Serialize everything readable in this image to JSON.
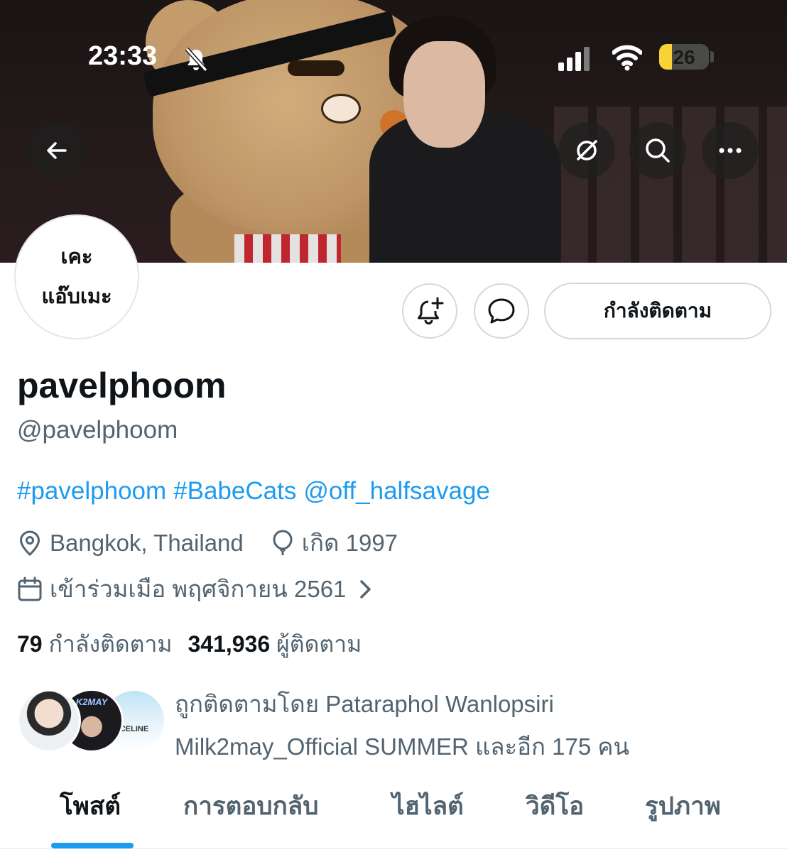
{
  "status_bar": {
    "time": "23:33",
    "battery_level": "26",
    "battery_fraction": 0.26
  },
  "header": {
    "back_icon": "arrow-left-icon",
    "grok_icon": "grok-icon",
    "search_icon": "search-icon",
    "more_icon": "more-icon"
  },
  "avatar": {
    "line1": "เคะ",
    "line2": "แอ๊บเมะ"
  },
  "actions": {
    "notify_icon": "bell-plus-icon",
    "message_icon": "message-icon",
    "following_label": "กำลังติดตาม"
  },
  "profile": {
    "display_name": "pavelphoom",
    "handle": "@pavelphoom",
    "bio_tags": [
      "#pavelphoom",
      "#BabeCats",
      "@off_halfsavage"
    ],
    "location": "Bangkok, Thailand",
    "born": "เกิด 1997",
    "joined": "เข้าร่วมเมือ พฤศจิกายน 2561"
  },
  "stats": {
    "following_count": "79",
    "following_label": "กำลังติดตาม",
    "followers_count": "341,936",
    "followers_label": "ผู้ติดตาม"
  },
  "followed_by": {
    "line1": "ถูกติดตามโดย Pataraphol Wanlopsiri",
    "line2": "Milk2may_Official SUMMER และอีก 175 คน",
    "avatar2_text": "K2MAY",
    "avatar3_text": "CELINE"
  },
  "tabs": [
    {
      "label": "โพสต์",
      "active": true
    },
    {
      "label": "การตอบกลับ",
      "active": false
    },
    {
      "label": "ไฮไลต์",
      "active": false
    },
    {
      "label": "วิดีโอ",
      "active": false
    },
    {
      "label": "รูปภาพ",
      "active": false
    }
  ],
  "colors": {
    "accent": "#1d9bf0",
    "text_primary": "#0f1419",
    "text_secondary": "#536471",
    "border": "#cfd9de"
  }
}
